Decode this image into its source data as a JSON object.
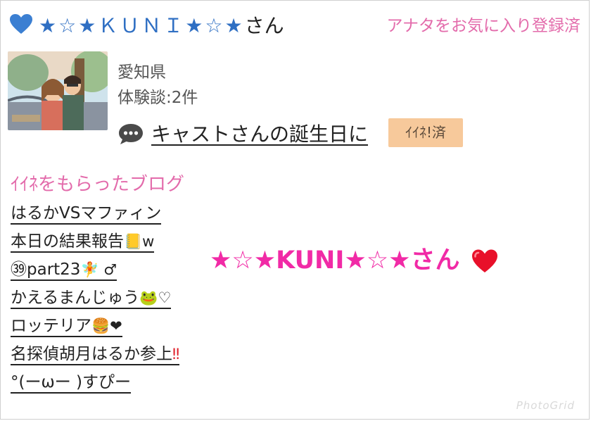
{
  "header": {
    "name": "★☆★ＫＵＮＩ★☆★",
    "name_suffix": "さん",
    "favorite_status": "アナタをお気に入り登録済"
  },
  "profile": {
    "prefecture": "愛知県",
    "report_count": "体験談:2件",
    "post_title": "キャストさんの誕生日に",
    "like_badge": "ｲｲﾈ!済"
  },
  "blogs": {
    "section_title": "ｲｲﾈをもらったブログ",
    "items": [
      {
        "text": "はるかVSマファィン",
        "emoji": ""
      },
      {
        "text": "本日の結果報告",
        "emoji": "📒w"
      },
      {
        "text": "㊴part23",
        "emoji": "🧚 ♂"
      },
      {
        "text": "かえるまんじゅう",
        "emoji": "🐸♡"
      },
      {
        "text": "ロッテリア",
        "emoji": "🍔❤"
      },
      {
        "text": "名探偵胡月はるか参上",
        "emoji": "‼"
      },
      {
        "text": "°(ーωー )すぴー",
        "emoji": ""
      }
    ]
  },
  "overlay": {
    "name": "★☆★KUNI★☆★さん"
  },
  "colors": {
    "accent_pink": "#e36bab",
    "overlay_pink": "#f12aa6",
    "name_blue": "#2f6fc3",
    "badge_bg": "#f7c99b"
  },
  "watermark": "PhotoGrid"
}
